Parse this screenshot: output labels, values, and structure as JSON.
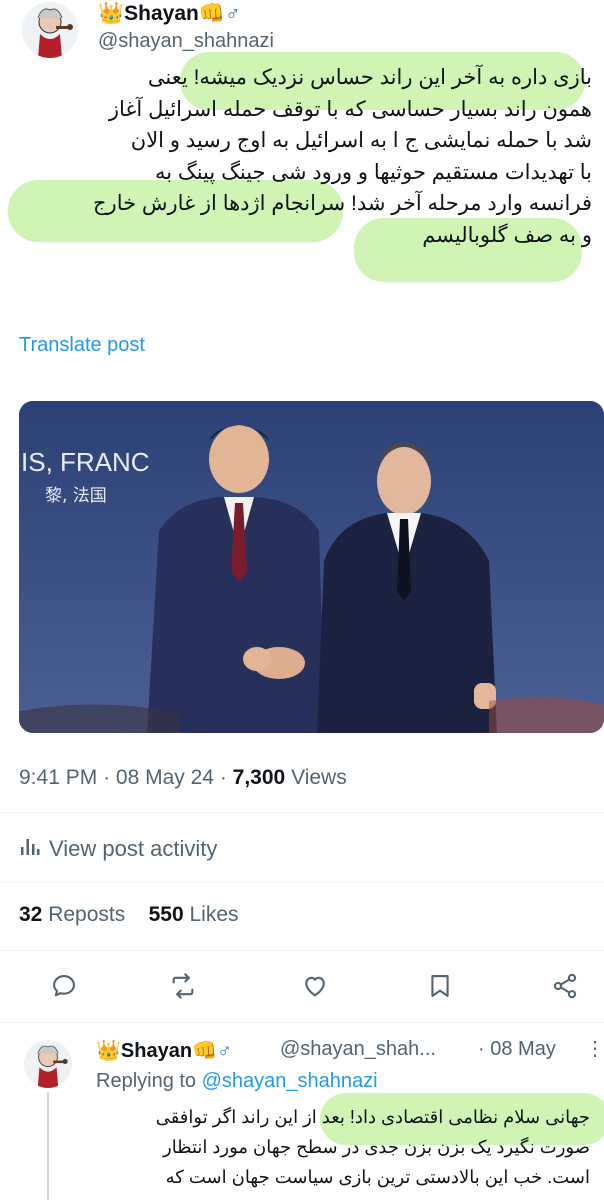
{
  "post": {
    "crown_emoji": "👑",
    "display_name": "Shayan",
    "name_emoji": "👊♂",
    "handle": "@shayan_shahnazi",
    "text_lines": [
      "بازی داره به آخر این راند حساس نزدیک میشه! یعنی",
      "همون راند بسیار حساسی که با توقف حمله اسرائیل آغاز",
      "شد با حمله نمایشی ج ا به اسرائیل به اوج رسید و الان",
      "با تهدیدات مستقیم حوثیها و ورود شی جینگ پینگ به",
      "فرانسه وارد مرحله آخر شد! سرانجام اژدها از غارش خارج",
      "و به صف گلوبالیسم"
    ],
    "translate_label": "Translate post",
    "image": {
      "backdrop_text": "IS, FRANC",
      "backdrop_text_2": "黎, 法国"
    },
    "time": "9:41 PM",
    "sep": "·",
    "date": "08 May 24",
    "views_count": "7,300",
    "views_label": "Views",
    "activity_label": "View post activity",
    "reposts_count": "32",
    "reposts_label": "Reposts",
    "likes_count": "550",
    "likes_label": "Likes"
  },
  "actions": [
    "reply-icon",
    "repost-icon",
    "like-icon",
    "bookmark-icon",
    "share-icon"
  ],
  "reply": {
    "crown_emoji": "👑",
    "display_name": "Shayan",
    "name_emoji": "👊♂",
    "handle": "@shayan_shah...",
    "sep": "·",
    "date": "08 May",
    "more": "⋮",
    "replying_label": "Replying to",
    "replying_handle": "@shayan_shahnazi",
    "text_lines": [
      "جهانی سلام نظامی اقتصادی داد! بعد از این راند اگر توافقی",
      "صورت نگیرد یک بزن بزن جدی در سطح جهان مورد انتظار",
      "است. خب این بالادستی ترین بازی سیاست جهان است که"
    ]
  },
  "colors": {
    "accent": "#1d9bf0",
    "muted": "#536471",
    "highlight": "#bef096"
  }
}
